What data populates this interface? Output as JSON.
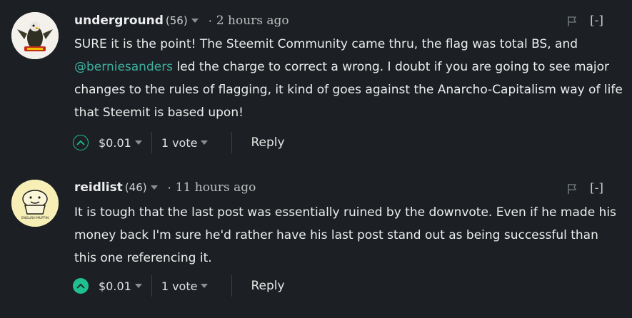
{
  "comments": [
    {
      "author": "underground",
      "reputation": "(56)",
      "separator": "·",
      "time": "2 hours ago",
      "collapse_label": "[-]",
      "body_before": "SURE it is the point! The Steemit Community came thru, the flag was total BS, and ",
      "mention": "@berniesanders",
      "body_after": " led the charge to correct a wrong. I doubt if you are going to see major changes to the rules of flagging, it kind of goes against the Anarcho-Capitalism way of life that Steemit is based upon!",
      "payout": "$0.01",
      "votes": "1 vote",
      "reply_label": "Reply",
      "voted": false
    },
    {
      "author": "reidlist",
      "reputation": "(46)",
      "separator": "·",
      "time": "11 hours ago",
      "collapse_label": "[-]",
      "body": "It is tough that the last post was essentially ruined by the downvote. Even if he made his money back I'm sure he'd rather have his last post stand out as being successful than this one referencing it.",
      "payout": "$0.01",
      "votes": "1 vote",
      "reply_label": "Reply",
      "voted": true,
      "avatar_text": "ENGLISH MUFFIN"
    }
  ],
  "colors": {
    "background": "#1c2024",
    "upvote": "#1fbf8f",
    "mention": "#3fb0a0"
  },
  "icons": [
    "flag-icon",
    "upvote-icon",
    "caret-down-icon"
  ]
}
